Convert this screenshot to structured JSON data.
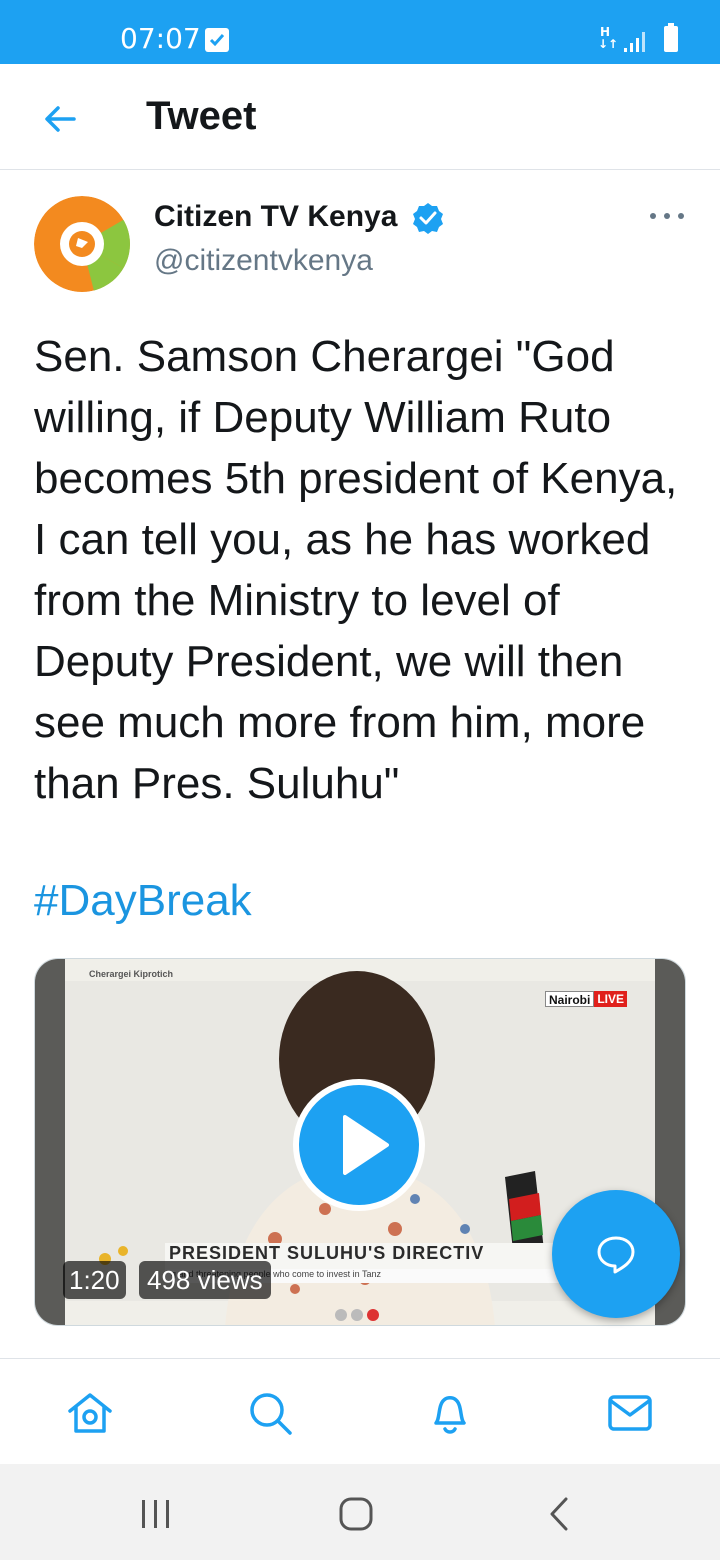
{
  "status_bar": {
    "time": "07:07",
    "network": "H",
    "colors": {
      "background": "#1da1f2"
    }
  },
  "header": {
    "title": "Tweet",
    "back_icon": "arrow-left-icon"
  },
  "tweet": {
    "author_name": "Citizen TV Kenya",
    "handle": "@citizentvkenya",
    "verified": true,
    "text": "Sen. Samson Cherargei \"God willing, if Deputy William Ruto becomes 5th president of Kenya, I can tell you, as he has worked from the Ministry to level of Deputy President, we will then see much more from him, more than Pres. Suluhu\"",
    "hashtag": "#DayBreak",
    "media": {
      "type": "video",
      "duration": "1:20",
      "views": "498 views",
      "caller_label": "Cherargei Kiprotich",
      "badge_left": "Nairobi",
      "badge_right": "LIVE",
      "headline": "PRESIDENT SULUHU'S DIRECTIV",
      "subline": "g and threatening people who come to invest in Tanz"
    }
  },
  "bottom_nav": {
    "items": [
      "home-icon",
      "search-icon",
      "bell-icon",
      "mail-icon"
    ]
  },
  "system_nav": {
    "items": [
      "recent-apps-icon",
      "home-circle-icon",
      "back-chevron-icon"
    ]
  },
  "colors": {
    "accent": "#1da1f2",
    "link": "#1b95e0",
    "secondary_text": "#657786"
  }
}
